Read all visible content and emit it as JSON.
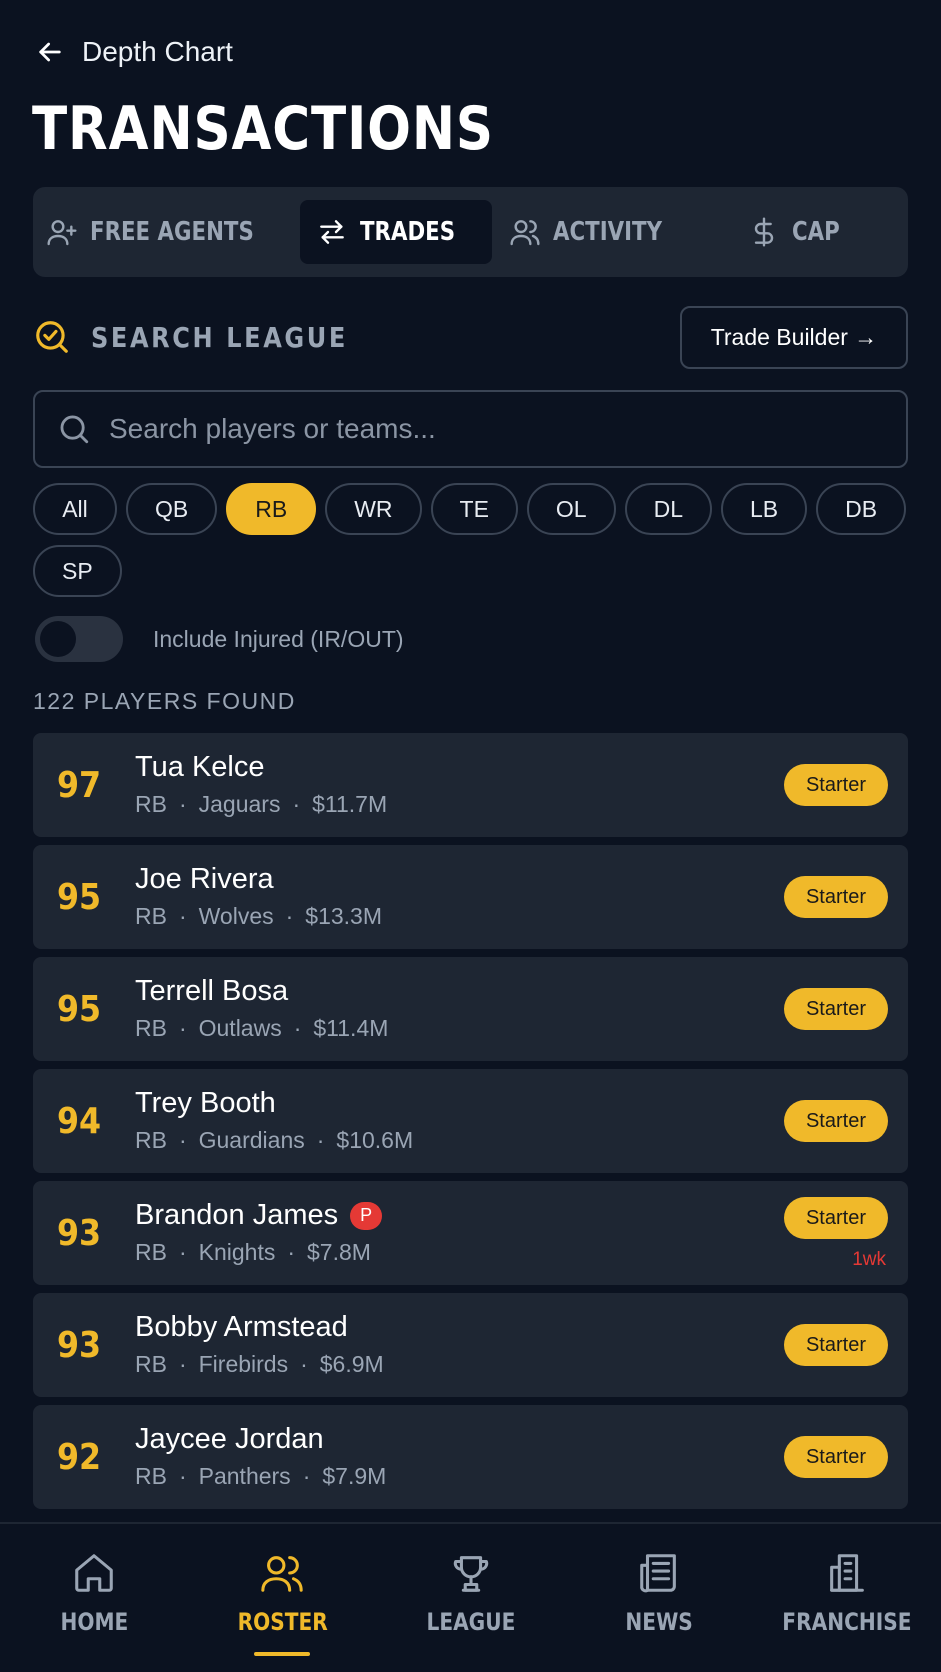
{
  "header": {
    "back_label": "Depth Chart",
    "title": "TRANSACTIONS"
  },
  "tabs": [
    {
      "label": "FREE AGENTS",
      "icon": "user-plus-icon",
      "active": false
    },
    {
      "label": "TRADES",
      "icon": "swap-arrows-icon",
      "active": true
    },
    {
      "label": "ACTIVITY",
      "icon": "users-icon",
      "active": false
    },
    {
      "label": "CAP",
      "icon": "dollar-icon",
      "active": false
    }
  ],
  "search": {
    "section_title": "SEARCH LEAGUE",
    "trade_builder_label": "Trade Builder →",
    "placeholder": "Search players or teams..."
  },
  "filters": {
    "positions": [
      "All",
      "QB",
      "RB",
      "WR",
      "TE",
      "OL",
      "DL",
      "LB",
      "DB",
      "SP"
    ],
    "selected": "RB"
  },
  "toggle": {
    "label": "Include Injured (IR/OUT)",
    "on": false
  },
  "results_count": "122 PLAYERS FOUND",
  "players": [
    {
      "rating": "97",
      "name": "Tua Kelce",
      "pos": "RB",
      "team": "Jaguars",
      "salary": "$11.7M",
      "status": "Starter"
    },
    {
      "rating": "95",
      "name": "Joe Rivera",
      "pos": "RB",
      "team": "Wolves",
      "salary": "$13.3M",
      "status": "Starter"
    },
    {
      "rating": "95",
      "name": "Terrell Bosa",
      "pos": "RB",
      "team": "Outlaws",
      "salary": "$11.4M",
      "status": "Starter"
    },
    {
      "rating": "94",
      "name": "Trey Booth",
      "pos": "RB",
      "team": "Guardians",
      "salary": "$10.6M",
      "status": "Starter"
    },
    {
      "rating": "93",
      "name": "Brandon James",
      "pos": "RB",
      "team": "Knights",
      "salary": "$7.8M",
      "status": "Starter",
      "badge": "P",
      "injury": "1wk"
    },
    {
      "rating": "93",
      "name": "Bobby Armstead",
      "pos": "RB",
      "team": "Firebirds",
      "salary": "$6.9M",
      "status": "Starter"
    },
    {
      "rating": "92",
      "name": "Jaycee Jordan",
      "pos": "RB",
      "team": "Panthers",
      "salary": "$7.9M",
      "status": "Starter"
    }
  ],
  "nav": [
    {
      "label": "HOME",
      "icon": "home-icon",
      "active": false
    },
    {
      "label": "ROSTER",
      "icon": "users-icon",
      "active": true
    },
    {
      "label": "LEAGUE",
      "icon": "trophy-icon",
      "active": false
    },
    {
      "label": "NEWS",
      "icon": "newspaper-icon",
      "active": false
    },
    {
      "label": "FRANCHISE",
      "icon": "building-icon",
      "active": false
    }
  ],
  "colors": {
    "background": "#0b1220",
    "card": "#1e2633",
    "accent": "#f0b92a",
    "muted": "#9aa5b4",
    "danger": "#e53935"
  }
}
